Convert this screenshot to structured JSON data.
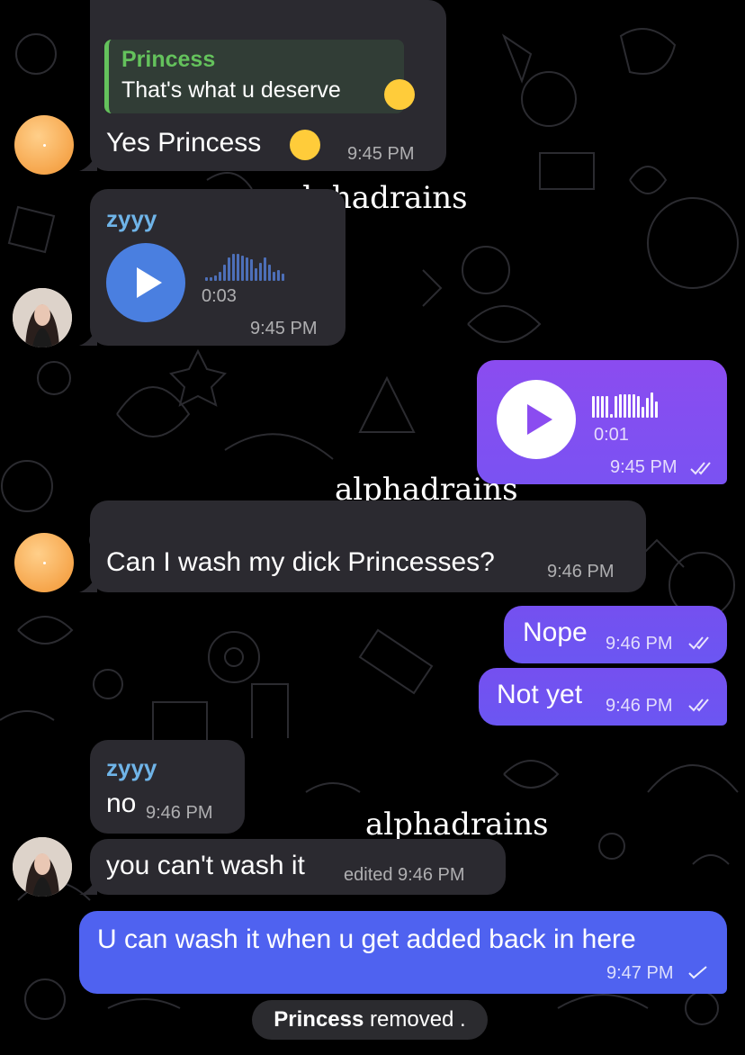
{
  "watermark": "alphadrains",
  "messages": {
    "m1": {
      "reply_name": "Princess",
      "reply_text": "That's what u deserve",
      "text": "Yes Princess",
      "time": "9:45 PM"
    },
    "m2": {
      "sender": "zyyy",
      "duration": "0:03",
      "time": "9:45 PM"
    },
    "m3": {
      "duration": "0:01",
      "time": "9:45 PM"
    },
    "m4": {
      "text": "Can I wash my dick Princesses?",
      "time": "9:46 PM"
    },
    "m5": {
      "text": "Nope",
      "time": "9:46 PM"
    },
    "m6": {
      "text": "Not yet",
      "time": "9:46 PM"
    },
    "m7": {
      "sender": "zyyy",
      "text": "no",
      "time": "9:46 PM"
    },
    "m8": {
      "text": "you can't wash it",
      "time": "edited 9:46 PM"
    },
    "m9": {
      "text": "U can wash it when u get added back in here",
      "time": "9:47 PM"
    }
  },
  "service": {
    "name": "Princess",
    "action": "removed ."
  },
  "colors": {
    "background": "#000000",
    "incoming_bubble": "#2b2a30",
    "sender_name": "#6fb4e8",
    "reply_accent": "#64c25c",
    "outgoing_purple": "#8b4cf0",
    "outgoing_blue": "#4f62f0",
    "avatar_orange": "#f6a64c",
    "play_button_blue": "#4a7fe0"
  },
  "icons": [
    "play-icon",
    "double-check-icon",
    "single-check-icon",
    "star-icon",
    "crying-face-emoji",
    "kiss-face-emoji"
  ]
}
